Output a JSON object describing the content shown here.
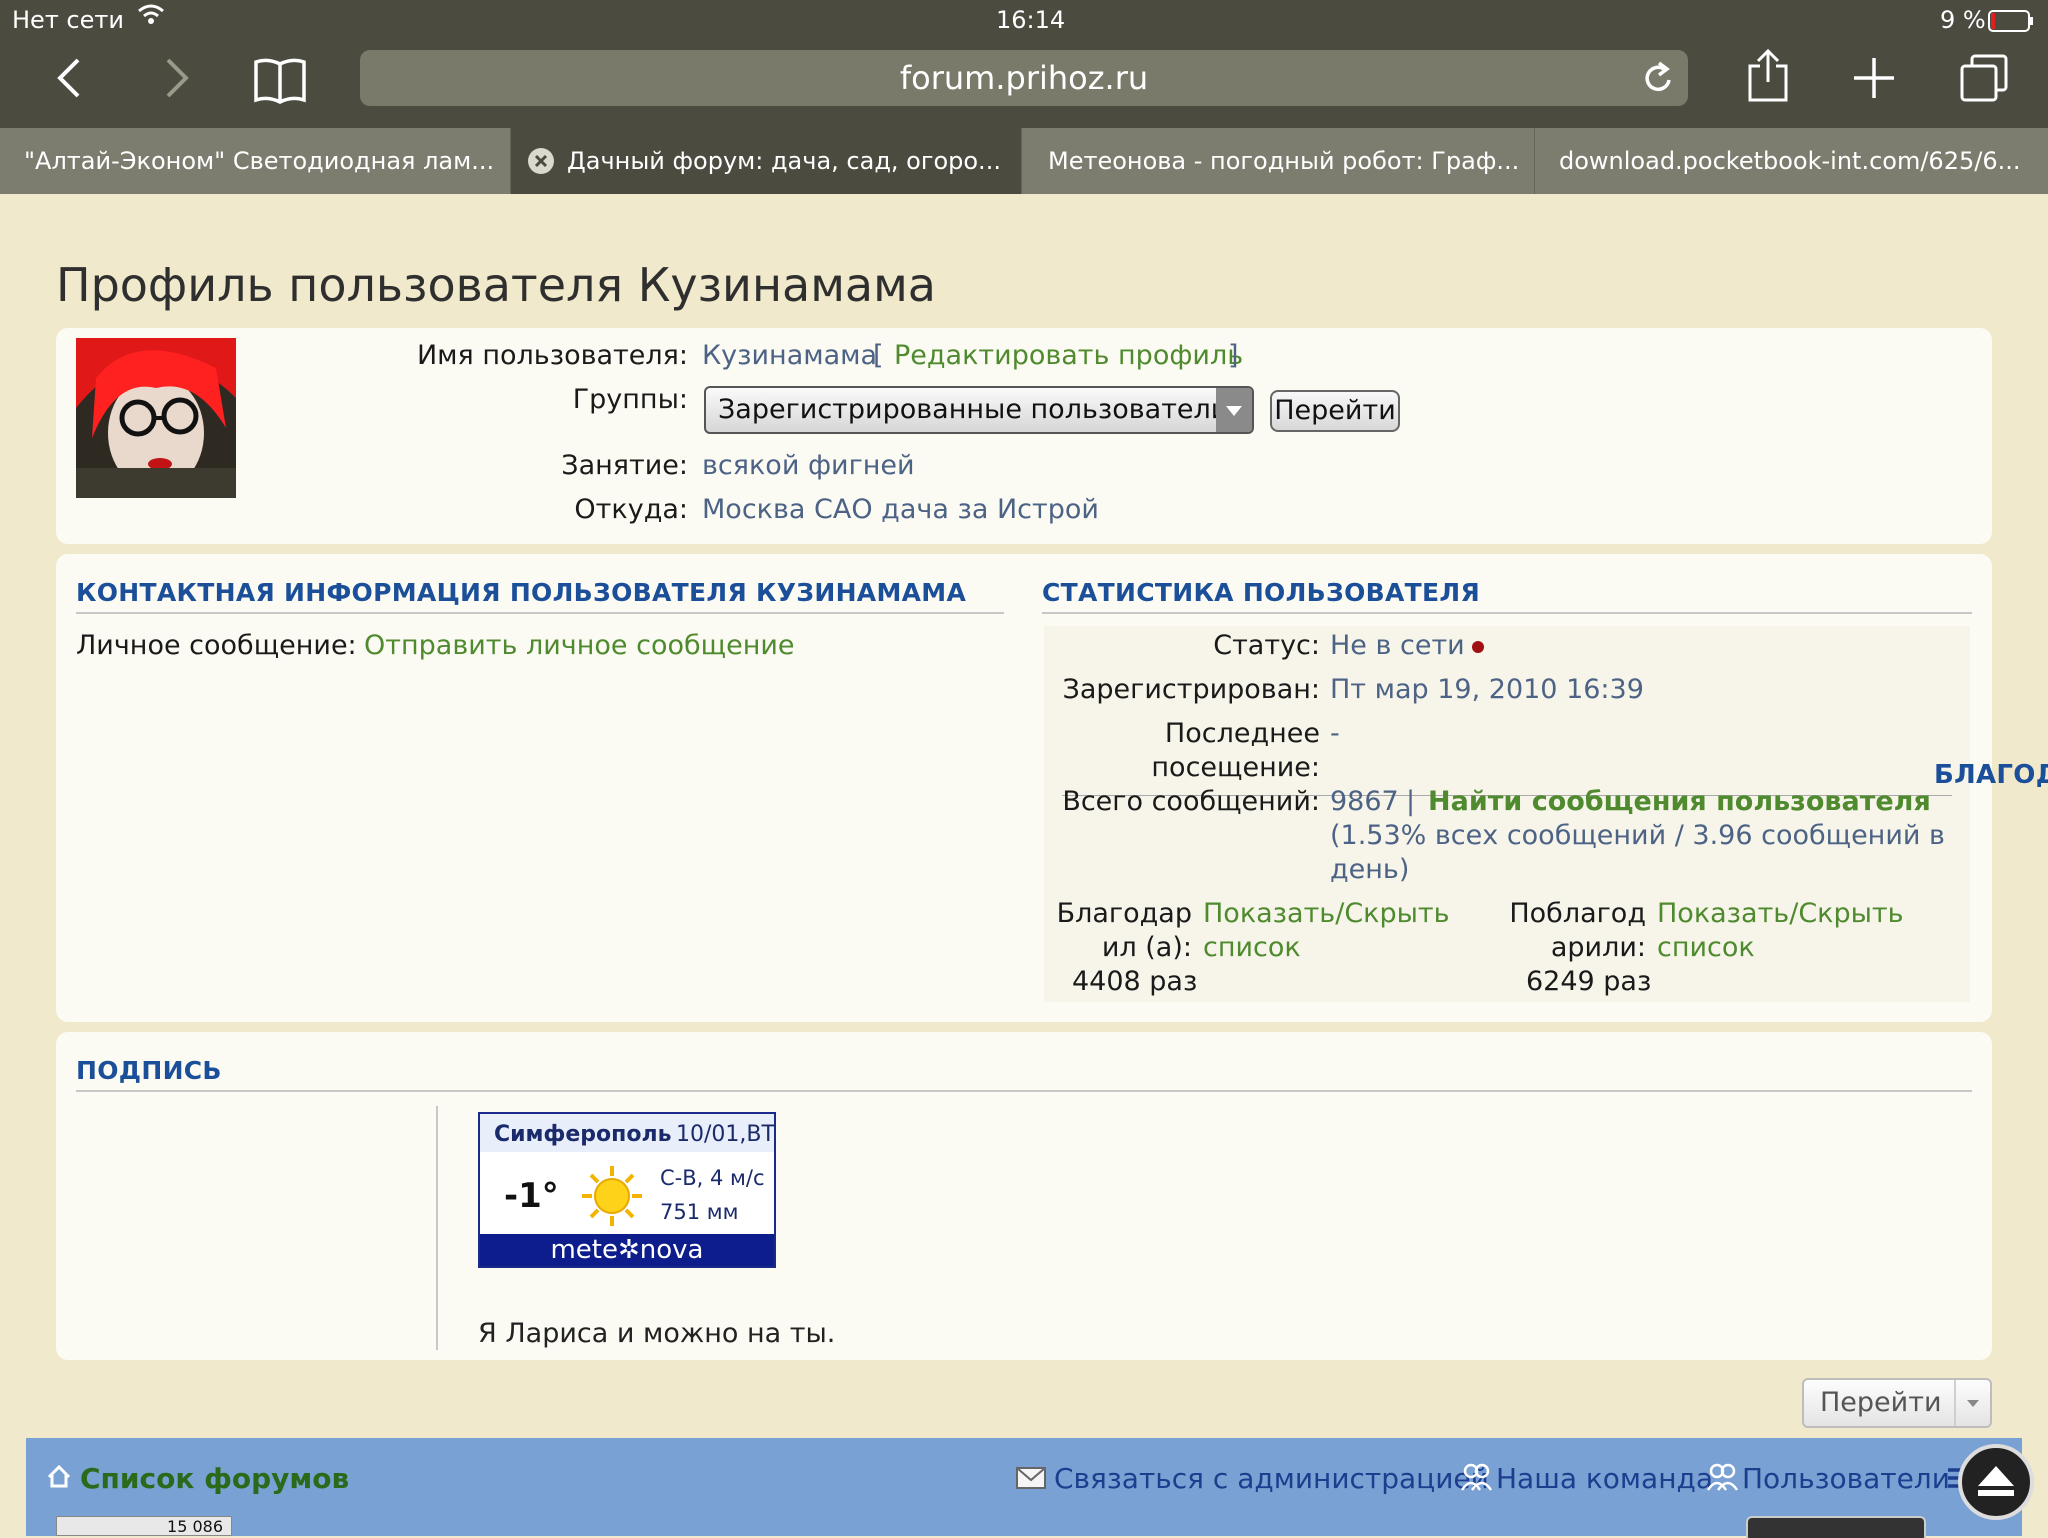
{
  "status_bar": {
    "network": "Нет сети",
    "time": "16:14",
    "battery": "9 %"
  },
  "browser": {
    "url": "forum.prihoz.ru"
  },
  "tabs": [
    {
      "title": "\"Алтай-Эконом\" Светодиодная лам..."
    },
    {
      "title": "Дачный форум: дача, сад, огоро..."
    },
    {
      "title": "Метеонова - погодный робот: Граф..."
    },
    {
      "title": "download.pocketbook-int.com/625/6..."
    }
  ],
  "page": {
    "title": "Профиль пользователя Кузинамама",
    "profile": {
      "username_label": "Имя пользователя:",
      "username": "Кузинамама",
      "edit_open": "[",
      "edit_link": "Редактировать профиль",
      "edit_close": "]",
      "groups_label": "Группы:",
      "groups_selected": "Зарегистрированные пользователи",
      "go_button": "Перейти",
      "occupation_label": "Занятие:",
      "occupation": "всякой фигней",
      "location_label": "Откуда:",
      "location": "Москва САО дача за Истрой"
    },
    "contact": {
      "heading": "КОНТАКТНАЯ ИНФОРМАЦИЯ ПОЛЬЗОВАТЕЛЯ КУЗИНАМАМА",
      "pm_label": "Личное сообщение:",
      "pm_link": "Отправить личное сообщение"
    },
    "stats": {
      "heading": "СТАТИСТИКА ПОЛЬЗОВАТЕЛЯ",
      "status_label": "Статус:",
      "status_value": "Не в сети",
      "registered_label": "Зарегистрирован:",
      "registered_value": "Пт мар 19, 2010 16:39",
      "last_visit_label_1": "Последнее",
      "last_visit_label_2": "посещение:",
      "last_visit_value": "-",
      "total_label": "Всего сообщений:",
      "total_count": "9867",
      "total_sep": "|",
      "find_posts": "Найти сообщения пользователя",
      "total_line2": "(1.53% всех сообщений / 3.96 сообщений в",
      "total_line3": "день)",
      "thanked_label_1": "Благодар",
      "thanked_label_2": "ил (а):",
      "thanked_count": "4408 раз",
      "thanked_toggle_1": "Показать/Скрыть",
      "thanked_toggle_2": "список",
      "received_label_1": "Поблагод",
      "received_label_2": "арили:",
      "received_count": "6249 раз",
      "received_toggle_1": "Показать/Скрыть",
      "received_toggle_2": "список",
      "overflow_heading": "БЛАГОД"
    },
    "signature": {
      "heading": "ПОДПИСЬ",
      "weather_city": "Симферополь",
      "weather_date": "10/01,ВТ",
      "weather_temp": "-1°",
      "weather_wind": "С-В, 4 м/с",
      "weather_pressure": "751 мм",
      "weather_brand": "mete✲nova",
      "text": "Я Лариса и можно на ты."
    },
    "jump_button": "Перейти",
    "footer": {
      "forums_list": "Список форумов",
      "contact_admin": "Связаться с администрацией",
      "our_team": "Наша команда",
      "users": "Пользователи",
      "counter": "15 086"
    }
  },
  "colors": {
    "page_bg": "#f0e9cc",
    "link_blue": "#4c6385",
    "link_green": "#4f8a2f",
    "heading_blue": "#1b4f9a",
    "footer_bar": "#7aa1d3"
  }
}
